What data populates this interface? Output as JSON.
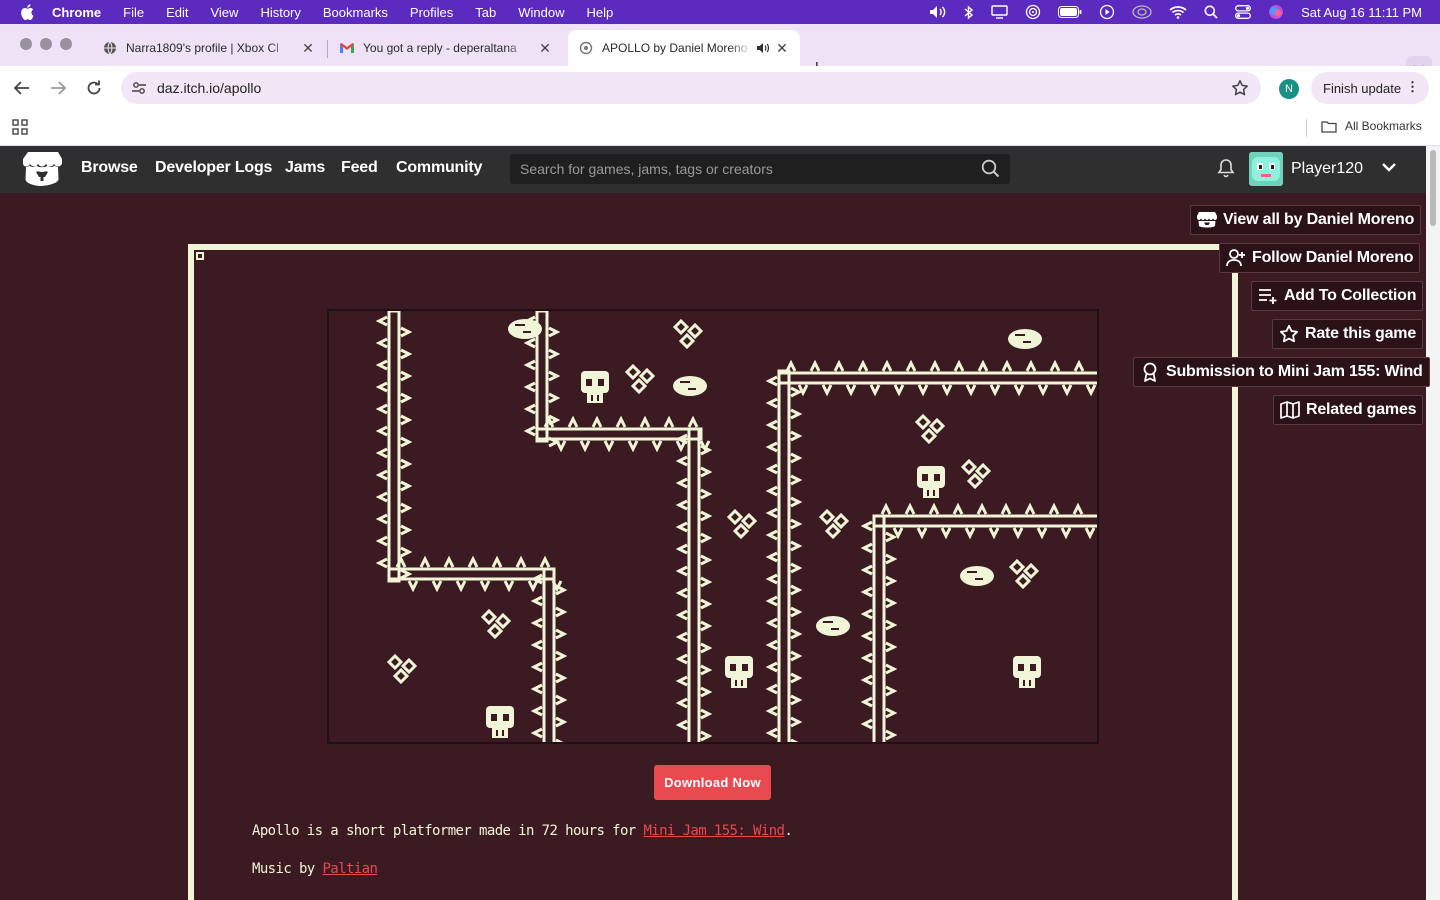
{
  "menubar": {
    "app": "Chrome",
    "items": [
      "File",
      "Edit",
      "View",
      "History",
      "Bookmarks",
      "Profiles",
      "Tab",
      "Window",
      "Help"
    ],
    "clock": "Sat Aug 16  11:11 PM"
  },
  "tabs": [
    {
      "title": "Narra1809's profile | Xbox Cl",
      "icon": "globe-icon"
    },
    {
      "title": "You got a reply - deperaltana",
      "icon": "gmail-icon"
    },
    {
      "title": "APOLLO by Daniel Moreno",
      "icon": "itch-icon",
      "audio": true,
      "active": true
    }
  ],
  "toolbar": {
    "url": "daz.itch.io/apollo",
    "profile_initial": "N",
    "finish_update": "Finish update"
  },
  "bookmarks": {
    "all": "All Bookmarks"
  },
  "itch": {
    "nav": [
      "Browse",
      "Developer Logs",
      "Jams",
      "Feed",
      "Community"
    ],
    "search_placeholder": "Search for games, jams, tags or creators",
    "username": "Player120"
  },
  "game": {
    "download": "Download Now",
    "desc_prefix": "Apollo is a short platformer made in 72 hours for ",
    "desc_link": "Mini Jam 155: Wind",
    "desc_suffix": ".",
    "music_prefix": "Music by ",
    "music_link": "Paltian"
  },
  "actions": [
    {
      "label": "View all by Daniel Moreno",
      "icon": "itch-store-icon"
    },
    {
      "label": "Follow Daniel Moreno",
      "icon": "follow-user-icon"
    },
    {
      "label": "Add To Collection",
      "icon": "add-to-list-icon"
    },
    {
      "label": "Rate this game",
      "icon": "star-icon"
    },
    {
      "label": "Submission to Mini Jam 155: Wind",
      "icon": "award-icon"
    },
    {
      "label": "Related games",
      "icon": "map-icon"
    }
  ],
  "colors": {
    "page_bg": "#3b1a22",
    "accent": "#e84a4f",
    "pixel_art": "#f1f5d8"
  }
}
